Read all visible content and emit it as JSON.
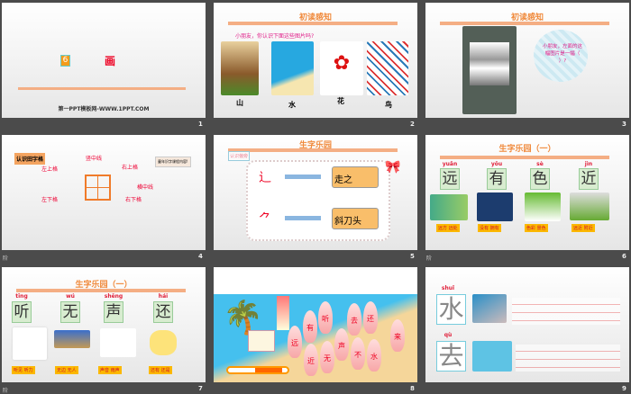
{
  "slides": [
    {
      "number": "1",
      "badge": "6",
      "title": "画",
      "footer": "第一PPT模板网-WWW.1PPT.COM"
    },
    {
      "number": "2",
      "heading": "初读感知",
      "question": "小朋友，你认识下面这些图片吗?",
      "words": [
        "山",
        "水",
        "花",
        "鸟"
      ]
    },
    {
      "number": "3",
      "heading": "初读感知",
      "bubble": "小朋友，左面的这幅图片是一幅（ ）?"
    },
    {
      "number": "4",
      "tag": "认识田字格",
      "banner": "童年识字课程内容!",
      "labels": {
        "top": "竖中线",
        "tl": "左上格",
        "tr": "右上格",
        "mid": "横中线",
        "bl": "左下格",
        "br": "右下格"
      },
      "corner": "阶"
    },
    {
      "number": "5",
      "heading": "生字乐园",
      "tag": "认识偏旁",
      "rows": [
        {
          "radical": "辶",
          "name": "走之"
        },
        {
          "radical": "⺈",
          "name": "斜刀头"
        }
      ]
    },
    {
      "number": "6",
      "heading": "生字乐园（一）",
      "chars": [
        {
          "py": "yuǎn",
          "ch": "远",
          "words": "远方 远处"
        },
        {
          "py": "yǒu",
          "ch": "有",
          "words": "没有 拥有"
        },
        {
          "py": "sè",
          "ch": "色",
          "words": "色彩 景色"
        },
        {
          "py": "jìn",
          "ch": "近",
          "words": "远近 附近"
        }
      ],
      "corner": "阶"
    },
    {
      "number": "7",
      "heading": "生字乐园（一）",
      "chars": [
        {
          "py": "tīng",
          "ch": "听",
          "words": "听见 听力"
        },
        {
          "py": "wú",
          "ch": "无",
          "words": "无边 无人"
        },
        {
          "py": "shēng",
          "ch": "声",
          "words": "声音 雨声"
        },
        {
          "py": "hái",
          "ch": "还",
          "words": "还有 还是"
        }
      ],
      "corner": "阶"
    },
    {
      "number": "8",
      "ships": [
        "远",
        "有",
        "听",
        "去",
        "还",
        "近",
        "无",
        "声",
        "不",
        "水",
        "来"
      ]
    },
    {
      "number": "9",
      "chars": [
        {
          "py": "shuǐ",
          "ch": "水"
        },
        {
          "py": "qù",
          "ch": "去"
        }
      ]
    }
  ],
  "colors": {
    "bg": "#4b4b4b",
    "accent": "#f08a3c",
    "red": "#e0203a",
    "yellow": "#fbb800"
  }
}
